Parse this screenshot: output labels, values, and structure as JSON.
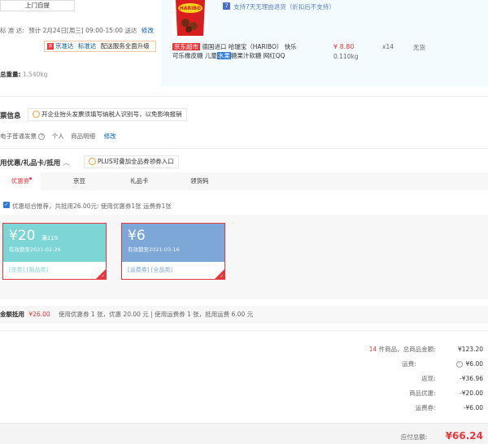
{
  "delivery": {
    "pickup_label": "上门自提",
    "standard_label": "标 准 达:",
    "estimate_text": "预计 2月24日[周三] 09:00-15:00 送达",
    "modify_label": "修改",
    "jd_express": "京准达",
    "standard_express": "标准达",
    "upgrade_text": "配送服务全面升级"
  },
  "product": {
    "return_policy": "支持7天无理由退货（折扣后不支持）",
    "store_tag": "京东超市",
    "name_part1": "德国进口 哈瑞宝（HARIBO） 快乐可乐橡皮糖 儿童",
    "keyword": "水果",
    "name_part2": "糖果汁软糖 网红QQ",
    "price": "¥ 8.80",
    "weight": "0.110kg",
    "quantity": "x14",
    "stock_status": "无货",
    "image_brand": "HARIBO"
  },
  "total_weight": {
    "label": "总重量:",
    "value": "1.540kg"
  },
  "invoice": {
    "title": "票信息",
    "tip": "开企业抬头发票须填写纳税人识别号，以免影响报销",
    "type": "电子普通发票",
    "person": "个人",
    "detail": "商品明细",
    "modify_label": "修改"
  },
  "discount": {
    "title": "用优惠/礼品卡/抵用",
    "plus_tip": "PLUS可叠加全品券领券入口",
    "tabs": [
      "优惠券",
      "京豆",
      "礼品卡",
      "领货码"
    ],
    "recommend_text": "优惠组合推荐，共抵用26.00元: 使用优惠券1张 运费券1张",
    "coupons": [
      {
        "amount": "¥20",
        "condition": "满119",
        "expiry": "有效期至2021-02-26",
        "tags": "[东券]  [限品类]",
        "color": "#7ed5d6"
      },
      {
        "amount": "¥6",
        "condition": "",
        "expiry": "有效期至2021-03-16",
        "tags": "[运费券]  [全品类]",
        "color": "#7da7d6"
      }
    ]
  },
  "summary": {
    "label": "金额抵用",
    "amount": "¥26.00",
    "detail": "使用优惠券 1 张，优惠 20.00 元  | 使用运费券 1 张，抵用运费 6.00 元"
  },
  "totals": {
    "item_count": "14",
    "item_label": "件商品，总商品金额:",
    "item_total": "¥123.20",
    "shipping_label": "运费:",
    "shipping_value": "¥6.00",
    "return_label": "返现:",
    "return_value": "-¥36.96",
    "discount_label": "商品优惠:",
    "discount_value": "-¥20.00",
    "shipping_coupon_label": "运费券:",
    "shipping_coupon_value": "-¥6.00",
    "payable_label": "应付总额:",
    "payable_value": "¥66.24"
  }
}
